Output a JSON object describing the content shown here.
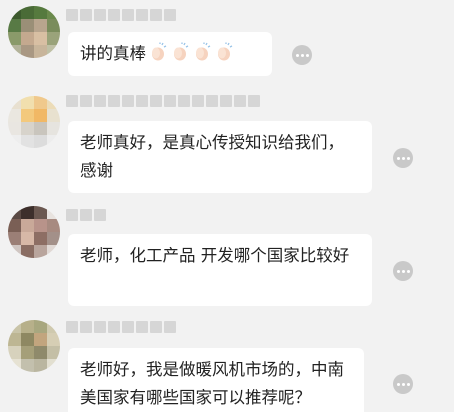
{
  "comments": [
    {
      "text": "讲的真棒",
      "emoji": "clapping-hands-icon",
      "emoji_count": 4
    },
    {
      "text": "老师真好，是真心传授知识给我们，感谢"
    },
    {
      "text": "老师，化工产品 开发哪个国家比较好"
    },
    {
      "text": "老师好，我是做暖风机市场的，中南美国家有哪些国家可以推荐呢？"
    }
  ],
  "more_icon": "more-options-icon",
  "colors": {
    "background": "#f2f2f2",
    "bubble": "#ffffff",
    "text": "#222222",
    "more_button": "#c9c9c9",
    "nickname_blur": "#d6d6d6"
  }
}
